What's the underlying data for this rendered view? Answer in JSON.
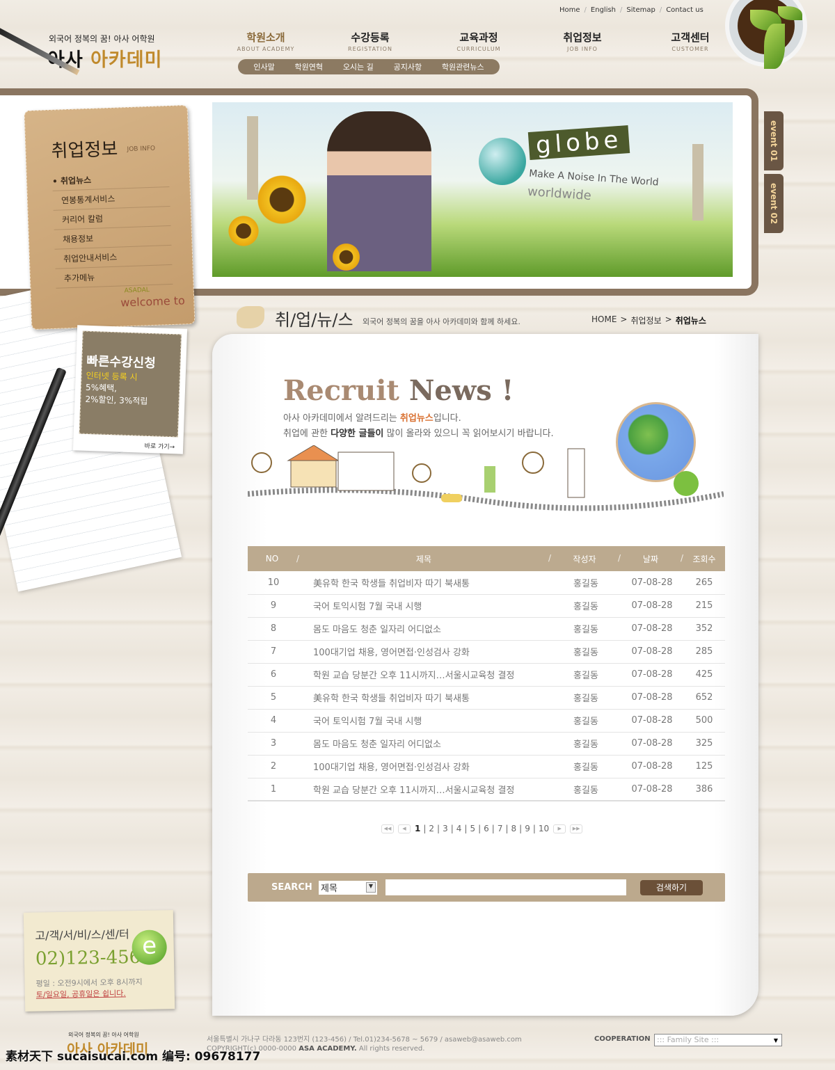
{
  "top_links": [
    "Home",
    "English",
    "Sitemap",
    "Contact us"
  ],
  "logo": {
    "tagline": "외국어 정복의 꿈! 아사 어학원",
    "name_a": "아사",
    "name_b": "아카데미"
  },
  "nav": [
    {
      "label": "학원소개",
      "sub": "ABOUT ACADEMY"
    },
    {
      "label": "수강등록",
      "sub": "REGISTATION"
    },
    {
      "label": "교육과정",
      "sub": "CURRICULUM"
    },
    {
      "label": "취업정보",
      "sub": "JOB INFO"
    },
    {
      "label": "고객센터",
      "sub": "CUSTOMER"
    }
  ],
  "subnav": [
    "인사말",
    "학원연혁",
    "오시는 길",
    "공지사항",
    "학원관련뉴스"
  ],
  "banner": {
    "title": "globe",
    "line1": "Make A Noise In The World",
    "line2": "worldwide"
  },
  "events": [
    "event 01",
    "event 02"
  ],
  "sidebar": {
    "title": "취업정보",
    "title_en": "JOB INFO",
    "items": [
      "취업뉴스",
      "연봉통계서비스",
      "커리어 칼럼",
      "채용정보",
      "취업안내서비스",
      "추가메뉴"
    ],
    "welcome": "welcome to",
    "brand": "ASADAL"
  },
  "quick": {
    "title": "빠른수강신청",
    "line1": "인터넷 등록 시",
    "line2": "5%혜택,",
    "line3": "2%할인, 3%적립",
    "go": "바로 가기→"
  },
  "page": {
    "title": "취/업/뉴/스",
    "desc": "외국어 정복의 꿈을 아사 아카데미와 함께 하세요.",
    "breadcrumb": [
      "HOME",
      ">",
      "취업정보",
      ">",
      "취업뉴스"
    ]
  },
  "intro": {
    "title_a": "Recruit",
    "title_b": "News !",
    "l1a": "아사 아카데미에서 알려드리는 ",
    "l1b": "취업뉴스",
    "l1c": "입니다.",
    "l2a": "취업에 관한 ",
    "l2b": "다양한 글들이",
    "l2c": " 많이 올라와 있으니 꼭 읽어보시기 바랍니다."
  },
  "table": {
    "headers": [
      "NO",
      "제목",
      "작성자",
      "날짜",
      "조회수"
    ],
    "rows": [
      [
        "10",
        "美유학 한국 학생들 취업비자 따기 북새통",
        "홍길동",
        "07-08-28",
        "265"
      ],
      [
        "9",
        "국어 토익시험 7월 국내 시행",
        "홍길동",
        "07-08-28",
        "215"
      ],
      [
        "8",
        "몸도 마음도 청춘 일자리 어디없소",
        "홍길동",
        "07-08-28",
        "352"
      ],
      [
        "7",
        "100대기업 채용, 영어면접·인성검사 강화",
        "홍길동",
        "07-08-28",
        "285"
      ],
      [
        "6",
        "학원 교습 당분간 오후 11시까지…서울시교육청 결정",
        "홍길동",
        "07-08-28",
        "425"
      ],
      [
        "5",
        "美유학 한국 학생들 취업비자 따기 북새통",
        "홍길동",
        "07-08-28",
        "652"
      ],
      [
        "4",
        "국어 토익시험 7월 국내 시행",
        "홍길동",
        "07-08-28",
        "500"
      ],
      [
        "3",
        "몸도 마음도 청춘 일자리 어디없소",
        "홍길동",
        "07-08-28",
        "325"
      ],
      [
        "2",
        "100대기업 채용, 영어면접·인성검사 강화",
        "홍길동",
        "07-08-28",
        "125"
      ],
      [
        "1",
        "학원 교습 당분간 오후 11시까지…서울시교육청 결정",
        "홍길동",
        "07-08-28",
        "386"
      ]
    ]
  },
  "pagination": {
    "pages": [
      "1",
      "2",
      "3",
      "4",
      "5",
      "6",
      "7",
      "8",
      "9",
      "10"
    ],
    "current": "1"
  },
  "search": {
    "label": "SEARCH",
    "field": "제목",
    "input_value": "",
    "button": "검색하기"
  },
  "customer": {
    "title": "고/객/서/비/스/센/터",
    "phone": "02)123-4567",
    "hours": "평일 : 오전9시에서 오후 8시까지",
    "closed": "토/일요일, 공휴일은 쉽니다."
  },
  "footer": {
    "tagline": "외국어 정복의 꿈! 아사 어학원",
    "logo": "아사 아카데미",
    "address": "서울특별시 가나구 다라동 123번지 (123-456) / Tel.01)234-5678 ~ 5679 / asaweb@asaweb.com",
    "copyright_a": "COPYRIGHT(c) 0000-0000 ",
    "copyright_b": "ASA ACADEMY.",
    "copyright_c": " All rights reserved.",
    "coop": "COOPERATION",
    "family": "::: Family Site :::"
  },
  "watermark": "素材天下 sucaisucai.com  编号: 09678177",
  "colors": {
    "brown": "#8c7a62",
    "table_header": "#bcaa8f",
    "accent": "#c08a2c"
  }
}
